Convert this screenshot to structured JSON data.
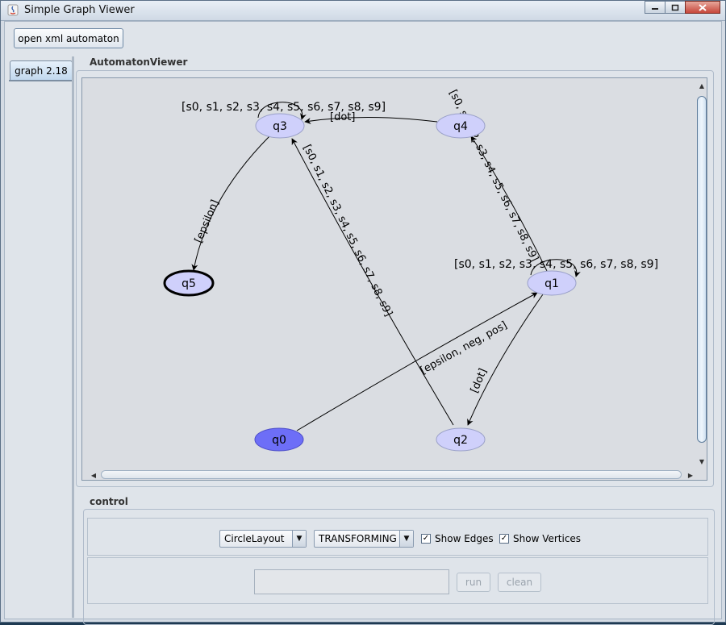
{
  "window": {
    "title": "Simple Graph Viewer"
  },
  "toolbar": {
    "open_label": "open xml automaton"
  },
  "tabs": [
    {
      "label": "graph 2.18",
      "selected": true
    }
  ],
  "viewer": {
    "title": "AutomatonViewer",
    "colors": {
      "initial_fill": "#6d6ef7",
      "state_fill": "#cfd0fb",
      "final_stroke": "#000000"
    },
    "nodes": [
      {
        "id": "q0",
        "label": "q0",
        "initial": true
      },
      {
        "id": "q1",
        "label": "q1"
      },
      {
        "id": "q2",
        "label": "q2"
      },
      {
        "id": "q3",
        "label": "q3"
      },
      {
        "id": "q4",
        "label": "q4"
      },
      {
        "id": "q5",
        "label": "q5",
        "final": true
      }
    ],
    "edges": [
      {
        "from": "q0",
        "to": "q1",
        "label": "[epsilon, neg, pos]"
      },
      {
        "from": "q1",
        "to": "q2",
        "label": "[dot]"
      },
      {
        "from": "q1",
        "to": "q4",
        "label": "[s0, s1, s2, s3, s4, s5, s6, s7, s8, s9]"
      },
      {
        "from": "q1",
        "to": "q1",
        "label": "[s0, s1, s2, s3, s4, s5, s6, s7, s8, s9]"
      },
      {
        "from": "q2",
        "to": "q3",
        "label": "[s0, s1, s2, s3, s4, s5, s6, s7, s8, s9]"
      },
      {
        "from": "q3",
        "to": "q3",
        "label": "[s0, s1, s2, s3, s4, s5, s6, s7, s8, s9]"
      },
      {
        "from": "q4",
        "to": "q3",
        "label": "[dot]"
      },
      {
        "from": "q3",
        "to": "q5",
        "label": "[epsilon]"
      }
    ]
  },
  "control": {
    "title": "control",
    "layout_select": "CircleLayout",
    "mode_select": "TRANSFORMING",
    "show_edges": {
      "label": "Show Edges",
      "checked": true
    },
    "show_vertices": {
      "label": "Show Vertices",
      "checked": true
    },
    "input_value": "",
    "run_label": "run",
    "clean_label": "clean"
  }
}
